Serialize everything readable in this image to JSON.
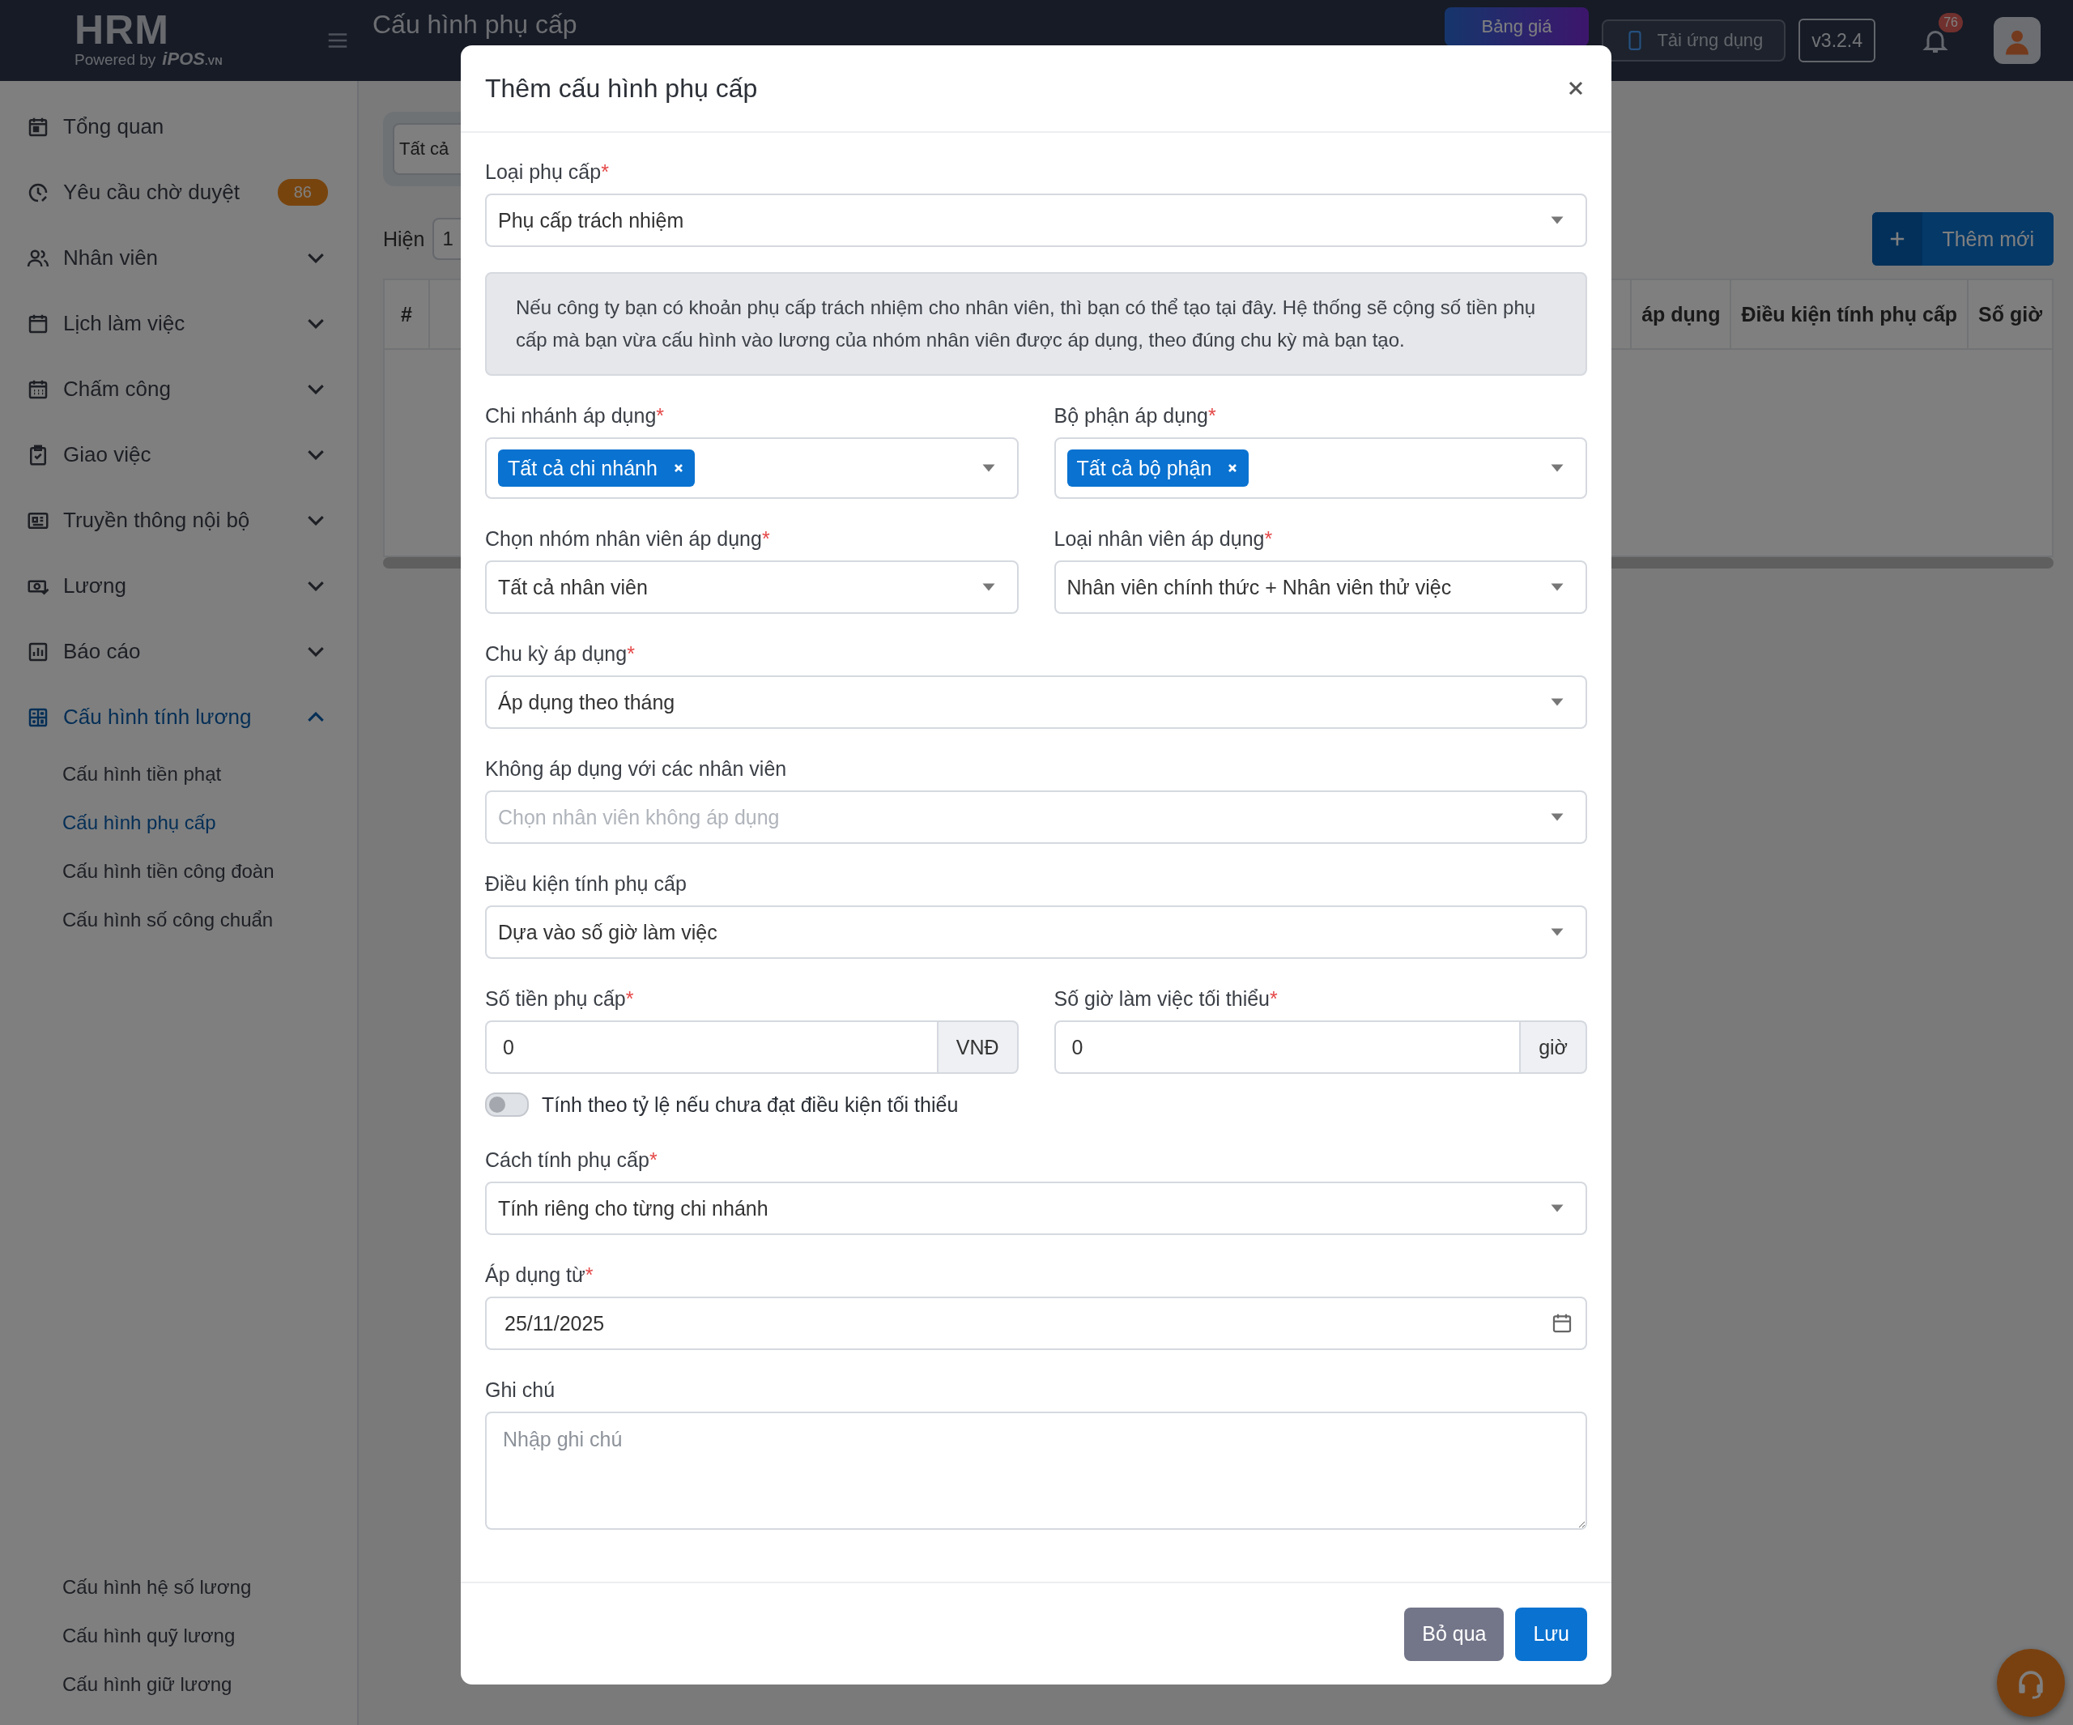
{
  "topbar": {
    "logo": "HRM",
    "powered_by": "Powered by",
    "brand": "iPOS",
    "brand_suffix": ".VN",
    "title": "Cấu hình phụ cấp",
    "pricing_button": "Bảng giá",
    "app_button": "Tải ứng dụng",
    "version": "v3.2.4",
    "notification_count": "76"
  },
  "sidebar": {
    "items": [
      {
        "label": "Tổng quan",
        "selected": false
      },
      {
        "label": "Yêu cầu chờ duyệt",
        "selected": false,
        "badge": "86"
      },
      {
        "label": "Nhân viên",
        "selected": false,
        "expanded": false
      },
      {
        "label": "Lịch làm việc",
        "selected": false,
        "expanded": false
      },
      {
        "label": "Chấm công",
        "selected": false,
        "expanded": false
      },
      {
        "label": "Giao việc",
        "selected": false,
        "expanded": false
      },
      {
        "label": "Truyền thông nội bộ",
        "selected": false,
        "expanded": false
      },
      {
        "label": "Lương",
        "selected": false,
        "expanded": false
      },
      {
        "label": "Báo cáo",
        "selected": false,
        "expanded": false
      },
      {
        "label": "Cấu hình tính lương",
        "selected": true,
        "expanded": true,
        "children": [
          {
            "label": "Cấu hình tiền phạt",
            "selected": false
          },
          {
            "label": "Cấu hình phụ cấp",
            "selected": true
          },
          {
            "label": "Cấu hình tiền công đoàn",
            "selected": false
          },
          {
            "label": "Cấu hình số công chuẩn",
            "selected": false
          }
        ]
      }
    ],
    "bottom_items": [
      {
        "label": "Cấu hình hệ số lương",
        "selected": false
      },
      {
        "label": "Cấu hình quỹ lương",
        "selected": false
      },
      {
        "label": "Cấu hình giữ lương",
        "selected": false
      }
    ]
  },
  "page": {
    "filter": "Tất cả",
    "show_label": "Hiện",
    "page_size": "1",
    "add_button": "Thêm mới",
    "columns": [
      "#",
      "áp dụng",
      "Điều kiện tính phụ cấp",
      "Số giờ"
    ]
  },
  "modal": {
    "title": "Thêm cấu hình phụ cấp",
    "rows": [
      [
        {
          "kind": "select",
          "label": "Loại phụ cấp",
          "required_mark": "*",
          "value": "Phụ cấp trách nhiệm"
        }
      ],
      [
        {
          "kind": "info",
          "text": "Nếu công ty bạn có khoản phụ cấp trách nhiệm cho nhân viên, thì bạn có thể tạo tại đây. Hệ thống sẽ cộng số tiền phụ cấp mà bạn vừa cấu hình vào lương của nhóm nhân viên được áp dụng, theo đúng chu kỳ mà bạn tạo."
        }
      ],
      [
        {
          "kind": "multiselect",
          "label": "Chi nhánh áp dụng",
          "required_mark": "*",
          "tags": [
            "Tất cả chi nhánh"
          ]
        },
        {
          "kind": "multiselect",
          "label": "Bộ phận áp dụng",
          "required_mark": "*",
          "tags": [
            "Tất cả bộ phận"
          ]
        }
      ],
      [
        {
          "kind": "select",
          "label": "Chọn nhóm nhân viên áp dụng",
          "required_mark": "*",
          "value": "Tất cả nhân viên"
        },
        {
          "kind": "select",
          "label": "Loại nhân viên áp dụng",
          "required_mark": "*",
          "value": "Nhân viên chính thức + Nhân viên thử việc"
        }
      ],
      [
        {
          "kind": "select",
          "label": "Chu kỳ áp dụng",
          "required_mark": "*",
          "value": "Áp dụng theo tháng"
        }
      ],
      [
        {
          "kind": "select",
          "label": "Không áp dụng với các nhân viên",
          "placeholder": "Chọn nhân viên không áp dụng"
        }
      ],
      [
        {
          "kind": "select",
          "label": "Điều kiện tính phụ cấp",
          "value": "Dựa vào số giờ làm việc"
        }
      ],
      [
        {
          "kind": "unit",
          "label": "Số tiền phụ cấp",
          "required_mark": "*",
          "value": "0",
          "unit": "VNĐ"
        },
        {
          "kind": "unit",
          "label": "Số giờ làm việc tối thiểu",
          "required_mark": "*",
          "value": "0",
          "unit": "giờ"
        }
      ],
      [
        {
          "kind": "toggle",
          "label": "Tính theo tỷ lệ nếu chưa đạt điều kiện tối thiểu",
          "on": false
        }
      ],
      [
        {
          "kind": "select",
          "label": "Cách tính phụ cấp",
          "required_mark": "*",
          "value": "Tính riêng cho từng chi nhánh"
        }
      ],
      [
        {
          "kind": "date",
          "label": "Áp dụng từ",
          "required_mark": "*",
          "value": "25/11/2025"
        }
      ],
      [
        {
          "kind": "textarea",
          "label": "Ghi chú",
          "placeholder": "Nhập ghi chú"
        }
      ]
    ],
    "cancel_button": "Bỏ qua",
    "save_button": "Lưu"
  }
}
